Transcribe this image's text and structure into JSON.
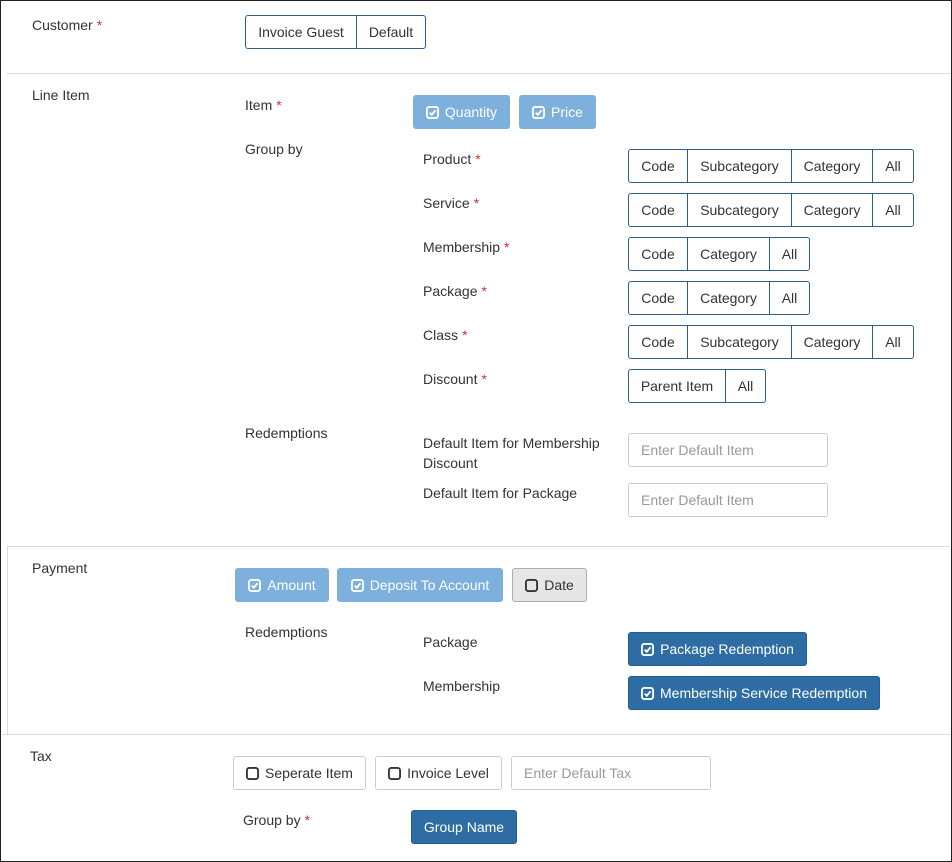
{
  "customer": {
    "label": "Customer",
    "required": "*",
    "options": [
      "Invoice Guest",
      "Default"
    ]
  },
  "line_item": {
    "label": "Line Item",
    "item": {
      "label": "Item",
      "required": "*",
      "buttons": [
        {
          "label": "Quantity",
          "icon": "checked-square-icon"
        },
        {
          "label": "Price",
          "icon": "checked-square-icon"
        }
      ]
    },
    "group_by": {
      "label": "Group by",
      "rows": [
        {
          "label": "Product",
          "required": "*",
          "options": [
            "Code",
            "Subcategory",
            "Category",
            "All"
          ]
        },
        {
          "label": "Service",
          "required": "*",
          "options": [
            "Code",
            "Subcategory",
            "Category",
            "All"
          ]
        },
        {
          "label": "Membership",
          "required": "*",
          "options": [
            "Code",
            "Category",
            "All"
          ]
        },
        {
          "label": "Package",
          "required": "*",
          "options": [
            "Code",
            "Category",
            "All"
          ]
        },
        {
          "label": "Class",
          "required": "*",
          "options": [
            "Code",
            "Subcategory",
            "Category",
            "All"
          ]
        },
        {
          "label": "Discount",
          "required": "*",
          "options": [
            "Parent Item",
            "All"
          ]
        }
      ]
    },
    "redemptions": {
      "label": "Redemptions",
      "membership_discount_label_line1": "Default Item for Membership",
      "membership_discount_label_line2": "Discount",
      "membership_discount_placeholder": "Enter Default Item",
      "package_label": "Default Item for Package",
      "package_placeholder": "Enter Default Item"
    }
  },
  "payment": {
    "label": "Payment",
    "buttons": [
      {
        "label": "Amount",
        "icon": "checked-square-icon"
      },
      {
        "label": "Deposit To Account",
        "icon": "checked-square-icon"
      },
      {
        "label": "Date",
        "icon": "unchecked-square-icon"
      }
    ],
    "redemptions": {
      "label": "Redemptions",
      "package_label": "Package",
      "package_button": "Package Redemption",
      "membership_label": "Membership",
      "membership_button": "Membership Service Redemption"
    }
  },
  "tax": {
    "label": "Tax",
    "buttons": [
      {
        "label": "Seperate Item",
        "icon": "unchecked-square-icon"
      },
      {
        "label": "Invoice Level",
        "icon": "unchecked-square-icon"
      }
    ],
    "default_tax_placeholder": "Enter Default Tax",
    "group_by_label": "Group by",
    "group_by_required": "*",
    "group_name_button": "Group Name"
  },
  "colors": {
    "accent": "#2e6da4",
    "accent_light": "#7eb0de",
    "segment_border": "#2a5f8c",
    "required": "#d9302f"
  }
}
